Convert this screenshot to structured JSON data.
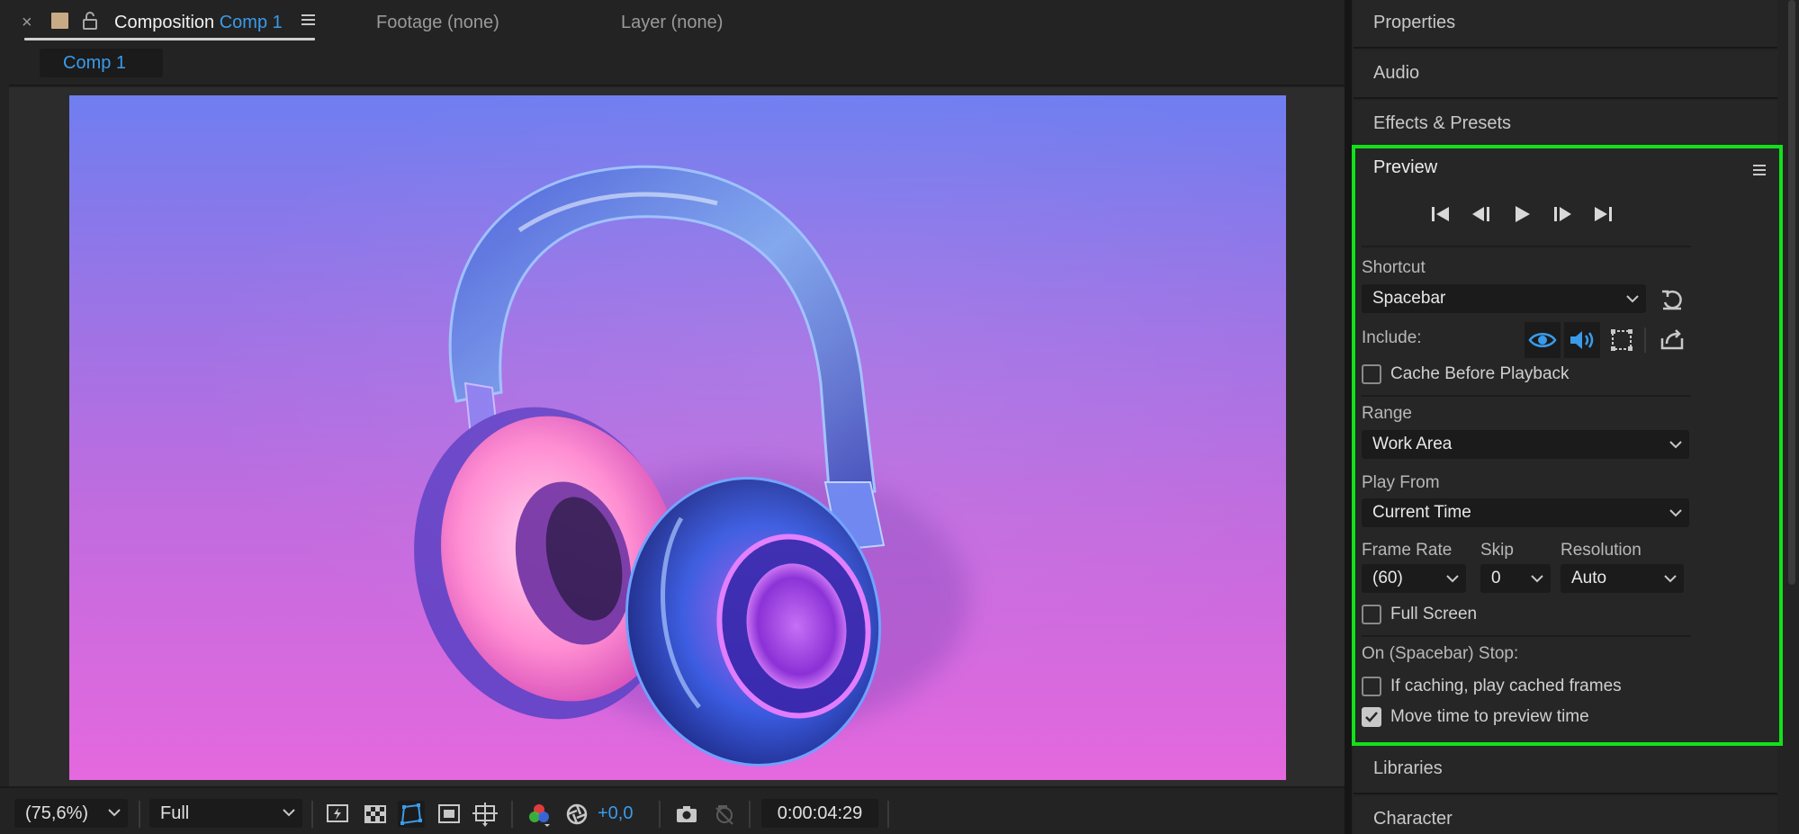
{
  "composition_tab": {
    "close": "×",
    "label": "Composition",
    "comp_name": "Comp 1",
    "menu_icon": "hamburger-menu-icon",
    "swatch_color": "#c8ab84"
  },
  "footage_tab": {
    "label": "Footage (none)"
  },
  "layer_tab": {
    "label": "Layer (none)"
  },
  "breadcrumb": {
    "label": "Comp 1"
  },
  "viewer": {
    "image_description": "3D iridescent headphones on purple-to-pink gradient",
    "gradient_top": "#6f7ef0",
    "gradient_bottom": "#e568de"
  },
  "viewer_controls": {
    "zoom": "(75,6%)",
    "resolution": "Full",
    "exposure_value": "+0,0",
    "timecode": "0:00:04:29",
    "icons": [
      "fast-preview-icon",
      "transparency-grid-icon",
      "mask-path-icon",
      "region-of-interest-icon",
      "grid-guides-icon",
      "color-channels-icon",
      "reset-exposure-icon",
      "snapshot-icon",
      "show-snapshot-icon"
    ]
  },
  "right_panels": {
    "properties": "Properties",
    "audio": "Audio",
    "effects": "Effects & Presets",
    "libraries": "Libraries",
    "character": "Character"
  },
  "preview": {
    "title": "Preview",
    "transport": [
      "first-frame-icon",
      "previous-frame-icon",
      "play-icon",
      "next-frame-icon",
      "last-frame-icon"
    ],
    "shortcut_label": "Shortcut",
    "shortcut_value": "Spacebar",
    "include_label": "Include:",
    "cache_before_playback": {
      "label": "Cache Before Playback",
      "checked": false
    },
    "range_label": "Range",
    "range_value": "Work Area",
    "play_from_label": "Play From",
    "play_from_value": "Current Time",
    "frame_rate_label": "Frame Rate",
    "frame_rate_value": "(60)",
    "skip_label": "Skip",
    "skip_value": "0",
    "resolution_label": "Resolution",
    "resolution_value": "Auto",
    "full_screen": {
      "label": "Full Screen",
      "checked": false
    },
    "on_stop_label": "On (Spacebar) Stop:",
    "if_caching": {
      "label": "If caching, play cached frames",
      "checked": false
    },
    "move_time": {
      "label": "Move time to preview time",
      "checked": true
    },
    "highlight_color": "#13e01b",
    "accent_color": "#3a9bea"
  }
}
